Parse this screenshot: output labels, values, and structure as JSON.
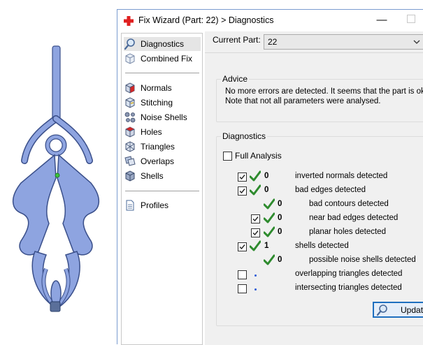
{
  "window": {
    "title": "Fix Wizard (Part: 22) > Diagnostics",
    "minimize_glyph": "—"
  },
  "nav": {
    "items": [
      {
        "label": "Diagnostics",
        "icon": "magnifier-icon"
      },
      {
        "label": "Combined Fix",
        "icon": "box-icon"
      },
      {
        "label": "Normals",
        "icon": "cube-red-icon"
      },
      {
        "label": "Stitching",
        "icon": "stitching-cube-icon"
      },
      {
        "label": "Noise Shells",
        "icon": "noise-shells-icon"
      },
      {
        "label": "Holes",
        "icon": "holes-cube-icon"
      },
      {
        "label": "Triangles",
        "icon": "triangles-icon"
      },
      {
        "label": "Overlaps",
        "icon": "overlaps-icon"
      },
      {
        "label": "Shells",
        "icon": "shells-icon"
      },
      {
        "label": "Profiles",
        "icon": "document-icon"
      }
    ],
    "selected": "Diagnostics"
  },
  "current_part": {
    "label": "Current Part:",
    "value": "22"
  },
  "advice": {
    "title": "Advice",
    "line1": "No more errors are detected. It seems that the part is ok.",
    "line2": "Note that not all parameters were analysed."
  },
  "diagnostics": {
    "title": "Diagnostics",
    "full_analysis_label": "Full Analysis",
    "full_analysis_checked": false,
    "rows": [
      {
        "checked": true,
        "status": "ok",
        "count": "0",
        "desc": "inverted normals detected"
      },
      {
        "checked": true,
        "status": "ok",
        "count": "0",
        "desc": "bad edges detected"
      },
      {
        "checked": null,
        "status": "ok",
        "count": "0",
        "desc": "bad contours detected"
      },
      {
        "checked": true,
        "status": "ok",
        "count": "0",
        "desc": "near bad edges detected"
      },
      {
        "checked": true,
        "status": "ok",
        "count": "0",
        "desc": "planar holes detected"
      },
      {
        "checked": true,
        "status": "ok",
        "count": "1",
        "desc": "shells detected"
      },
      {
        "checked": null,
        "status": "ok",
        "count": "0",
        "desc": "possible noise shells detected"
      },
      {
        "checked": false,
        "status": "pending",
        "count": "",
        "desc": "overlapping triangles detected"
      },
      {
        "checked": false,
        "status": "pending",
        "count": "",
        "desc": "intersecting triangles detected"
      }
    ]
  },
  "update_button": {
    "label": "Update"
  },
  "colors": {
    "accent": "#1e6fbf",
    "ok_tick": "#2e8b2e",
    "pending_dot": "#2a5bd7",
    "model_fill": "#8ea4e0"
  }
}
